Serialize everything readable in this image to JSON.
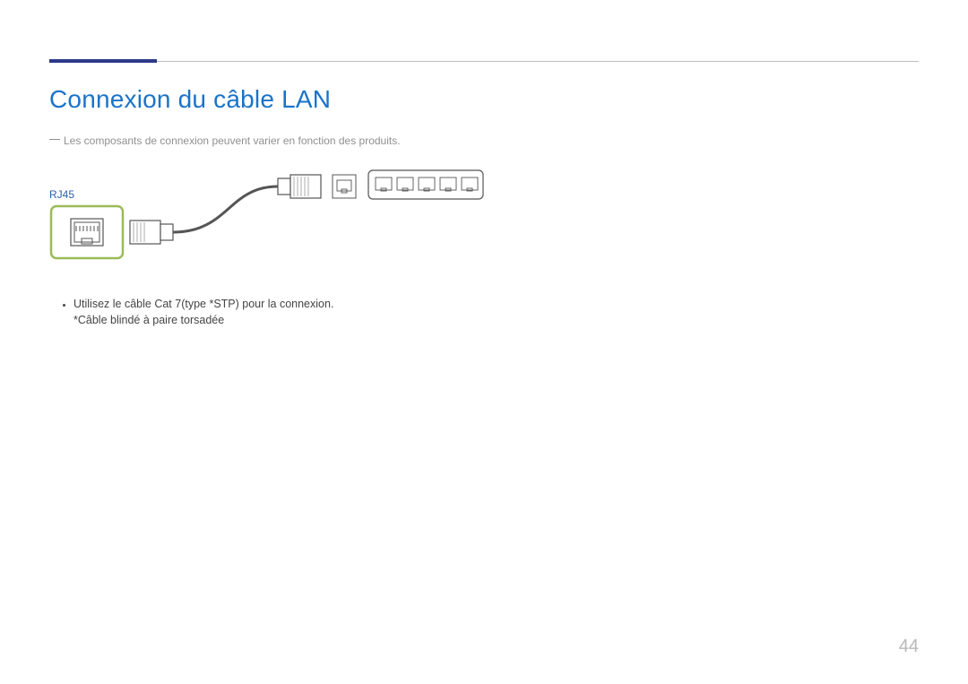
{
  "colors": {
    "accent_blue_title": "#1a73c8",
    "accent_navy_bar": "#2b3a87",
    "device_highlight_green": "#9bbb59",
    "port_label_blue": "#2b5fa8",
    "muted_gray": "#909090"
  },
  "header": {
    "title": "Connexion du câble LAN"
  },
  "note": {
    "text": "Les composants de connexion peuvent varier en fonction des produits."
  },
  "diagram": {
    "port_label": "RJ45",
    "device_icon": "rj45-port-icon",
    "cable_icon": "lan-cable-icon",
    "router_icon": "router-device-icon"
  },
  "bullets": [
    {
      "text": "Utilisez le câble Cat 7(type *STP) pour la connexion.",
      "sub": "*Câble blindé à paire torsadée"
    }
  ],
  "page_number": "44"
}
